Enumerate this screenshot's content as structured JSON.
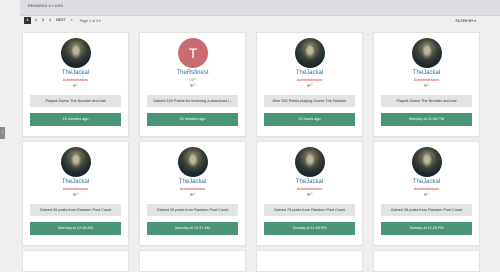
{
  "header": {
    "title": "Rewards & Logs"
  },
  "edge_tab": "›",
  "pagination": {
    "pages": [
      "1",
      "2",
      "3",
      "4"
    ],
    "next": "NEXT",
    "last": "»",
    "page_of": "Page 1 of 4"
  },
  "filter_label": "FILTER BY",
  "cards": [
    {
      "user": "TheJackal",
      "role": "Administrators",
      "count": "0",
      "message": "Played Guess The Number and lost",
      "time": "15 minutes ago"
    },
    {
      "user": "TheRsfinest",
      "role": "VIP",
      "count": "0",
      "message": "Gained 100 Points for receiving a download l...",
      "time": "20 minutes ago",
      "avatar_letter": "T"
    },
    {
      "user": "TheJackal",
      "role": "Administrators",
      "count": "0",
      "message": "Won 250 Points playing Guess The Number",
      "time": "20 hours ago"
    },
    {
      "user": "TheJackal",
      "role": "Administrators",
      "count": "0",
      "message": "Played Guess The Number and lost",
      "time": "Monday at 01:56 PM"
    },
    {
      "user": "TheJackal",
      "role": "Administrators",
      "count": "0",
      "message": "Gained 39 posts from Random Post Count",
      "time": "Monday at 12:48 AM"
    },
    {
      "user": "TheJackal",
      "role": "Administrators",
      "count": "0",
      "message": "Gained 39 posts from Random Post Count",
      "time": "Monday at 12:37 AM"
    },
    {
      "user": "TheJackal",
      "role": "Administrators",
      "count": "0",
      "message": "Gained 79 posts from Random Post Count",
      "time": "Sunday at 11:55 PM"
    },
    {
      "user": "TheJackal",
      "role": "Administrators",
      "count": "0",
      "message": "Gained 38 posts from Random Post Count",
      "time": "Sunday at 11:26 PM"
    }
  ]
}
